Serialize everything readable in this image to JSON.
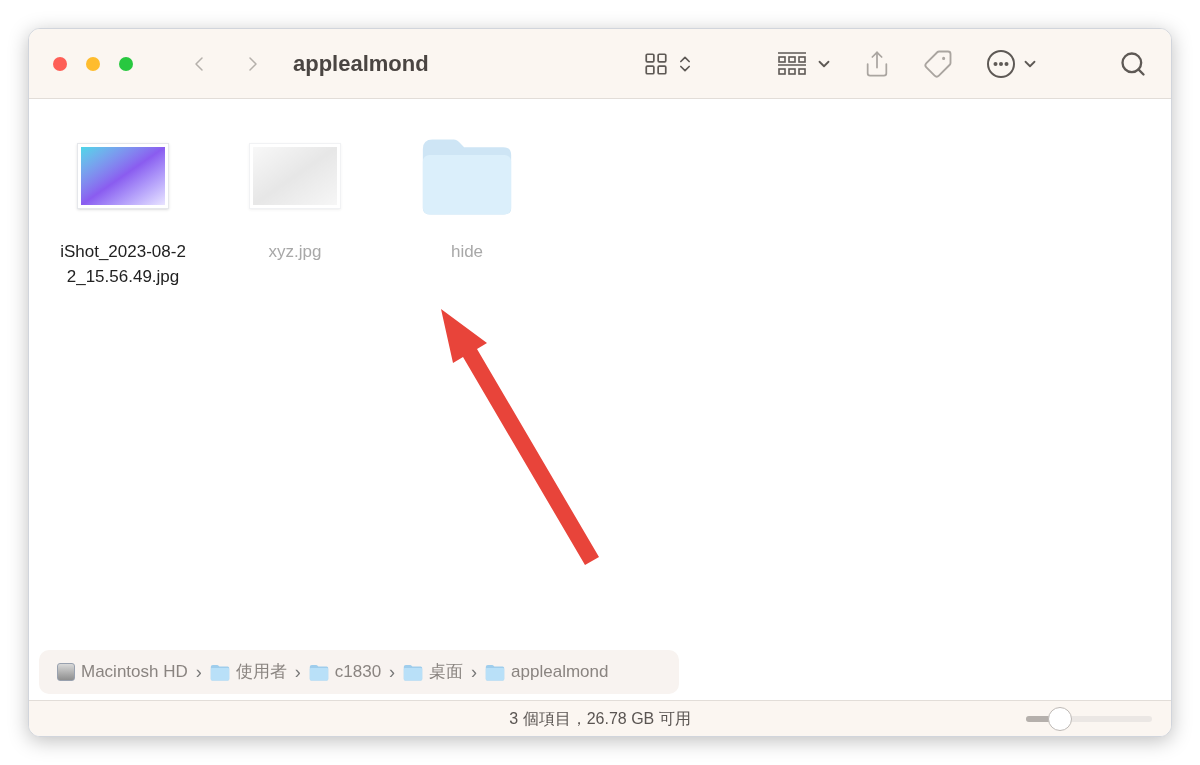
{
  "window": {
    "title": "applealmond"
  },
  "files": [
    {
      "name": "iShot_2023-08-2\n2_15.56.49.jpg",
      "kind": "image",
      "hidden": false
    },
    {
      "name": "xyz.jpg",
      "kind": "image",
      "hidden": true
    },
    {
      "name": "hide",
      "kind": "folder",
      "hidden": true
    }
  ],
  "path_bar": [
    {
      "label": "Macintosh HD",
      "kind": "disk"
    },
    {
      "label": "使用者",
      "kind": "folder"
    },
    {
      "label": "c1830",
      "kind": "folder"
    },
    {
      "label": "桌面",
      "kind": "folder"
    },
    {
      "label": "applealmond",
      "kind": "folder"
    }
  ],
  "path_separator": "›",
  "status_bar": {
    "text": "3 個項目，26.78 GB 可用",
    "zoom": {
      "level": 0.27
    }
  }
}
